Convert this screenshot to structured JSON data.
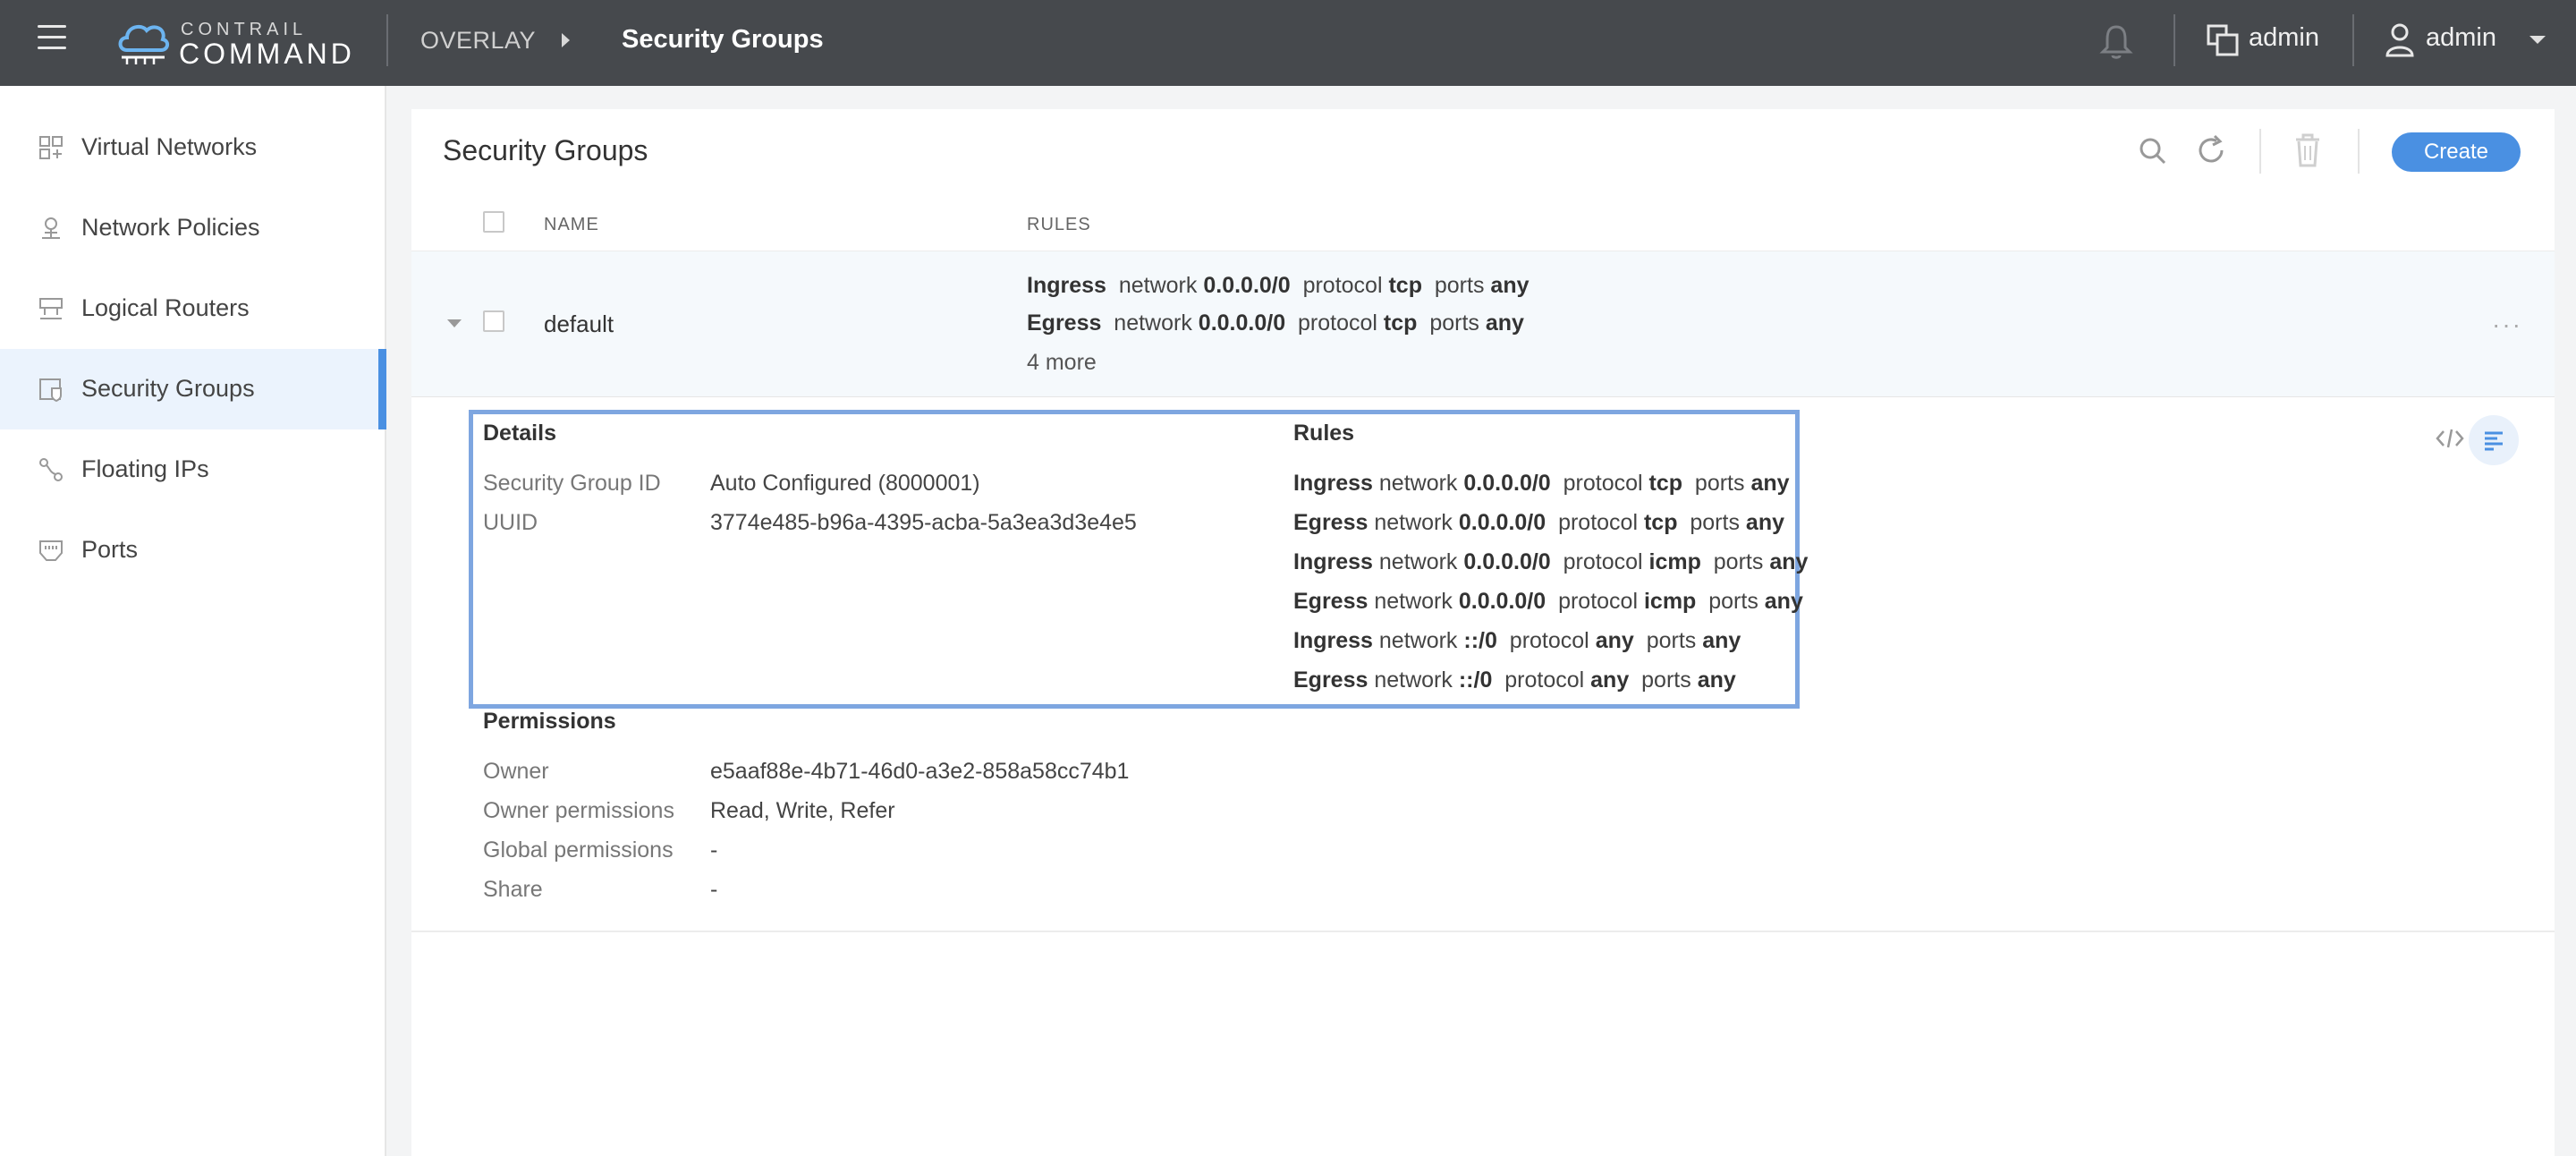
{
  "brand": {
    "line1": "CONTRAIL",
    "line2": "COMMAND"
  },
  "breadcrumb": {
    "section": "OVERLAY",
    "page": "Security Groups"
  },
  "header": {
    "project": "admin",
    "user": "admin"
  },
  "sidebar": {
    "items": [
      {
        "label": "Virtual Networks",
        "icon": "virtual-networks-icon"
      },
      {
        "label": "Network Policies",
        "icon": "network-policies-icon"
      },
      {
        "label": "Logical Routers",
        "icon": "logical-routers-icon"
      },
      {
        "label": "Security Groups",
        "icon": "security-groups-icon",
        "active": true
      },
      {
        "label": "Floating IPs",
        "icon": "floating-ips-icon"
      },
      {
        "label": "Ports",
        "icon": "ports-icon"
      }
    ]
  },
  "main": {
    "title": "Security Groups",
    "create_label": "Create",
    "columns": {
      "name": "NAME",
      "rules": "RULES"
    },
    "row": {
      "name": "default",
      "rules": [
        {
          "dir": "Ingress",
          "network": "0.0.0.0/0",
          "protocol": "tcp",
          "ports": "any"
        },
        {
          "dir": "Egress",
          "network": "0.0.0.0/0",
          "protocol": "tcp",
          "ports": "any"
        }
      ],
      "more": "4 more"
    }
  },
  "details": {
    "details_heading": "Details",
    "rules_heading": "Rules",
    "sg_id_label": "Security Group ID",
    "sg_id_value": "Auto Configured (8000001)",
    "uuid_label": "UUID",
    "uuid_value": "3774e485-b96a-4395-acba-5a3ea3d3e4e5",
    "word_network": "network",
    "word_protocol": "protocol",
    "word_ports": "ports",
    "rules": [
      {
        "dir": "Ingress",
        "network": "0.0.0.0/0",
        "protocol": "tcp",
        "ports": "any"
      },
      {
        "dir": "Egress",
        "network": "0.0.0.0/0",
        "protocol": "tcp",
        "ports": "any"
      },
      {
        "dir": "Ingress",
        "network": "0.0.0.0/0",
        "protocol": "icmp",
        "ports": "any"
      },
      {
        "dir": "Egress",
        "network": "0.0.0.0/0",
        "protocol": "icmp",
        "ports": "any"
      },
      {
        "dir": "Ingress",
        "network": "::/0",
        "protocol": "any",
        "ports": "any"
      },
      {
        "dir": "Egress",
        "network": "::/0",
        "protocol": "any",
        "ports": "any"
      }
    ],
    "permissions_heading": "Permissions",
    "owner_label": "Owner",
    "owner_value": "e5aaf88e-4b71-46d0-a3e2-858a58cc74b1",
    "owner_perms_label": "Owner permissions",
    "owner_perms_value": "Read, Write, Refer",
    "global_perms_label": "Global permissions",
    "global_perms_value": "-",
    "share_label": "Share",
    "share_value": "-"
  },
  "colors": {
    "accent": "#4a90e2",
    "topbar": "#46494d",
    "highlight_border": "#7ea6e0"
  }
}
